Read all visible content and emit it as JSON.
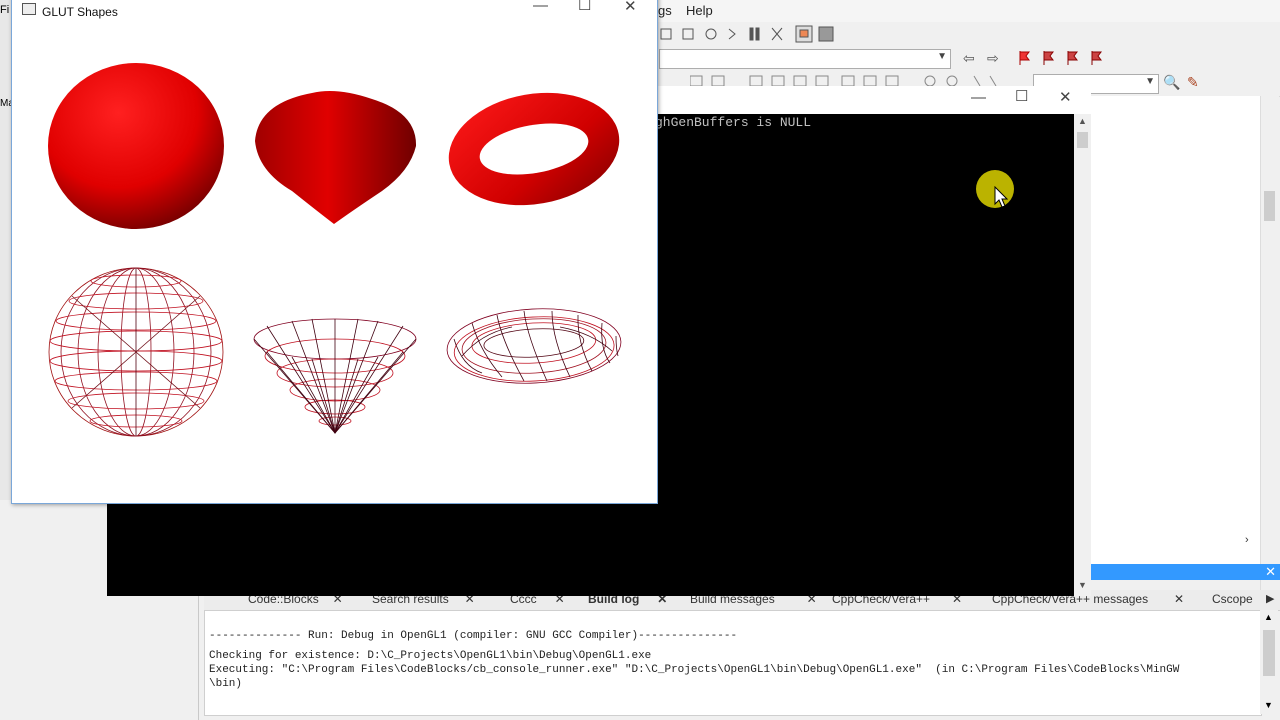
{
  "ide": {
    "menu": {
      "settings_partial": "gs",
      "help": "Help"
    },
    "left_menu_partial": "Fi",
    "left_panel_partial": "Ma",
    "log_tabs": [
      {
        "label": "Code::Blocks"
      },
      {
        "label": "Search results"
      },
      {
        "label": "Cccc"
      },
      {
        "label": "Build log",
        "active": true
      },
      {
        "label": "Build messages"
      },
      {
        "label": "CppCheck/Vera++"
      },
      {
        "label": "CppCheck/Vera++ messages"
      },
      {
        "label": "Cscope"
      }
    ],
    "log_lines": [
      "-------------- Run: Debug in OpenGL1 (compiler: GNU GCC Compiler)---------------",
      "Checking for existence: D:\\C_Projects\\OpenGL1\\bin\\Debug\\OpenGL1.exe",
      "Executing: \"C:\\Program Files\\CodeBlocks/cb_console_runner.exe\" \"D:\\C_Projects\\OpenGL1\\bin\\Debug\\OpenGL1.exe\"  (in C:\\Program Files\\CodeBlocks\\MinGW",
      "\\bin)"
    ]
  },
  "console": {
    "output": "ghGenBuffers is NULL"
  },
  "glut_window": {
    "title": "GLUT Shapes",
    "shape_color": "#e00000",
    "shapes": [
      "solid-sphere",
      "solid-cone",
      "solid-torus",
      "wire-sphere",
      "wire-cone",
      "wire-torus"
    ]
  },
  "colors": {
    "accent": "#3399ff",
    "console_bg": "#000000"
  }
}
